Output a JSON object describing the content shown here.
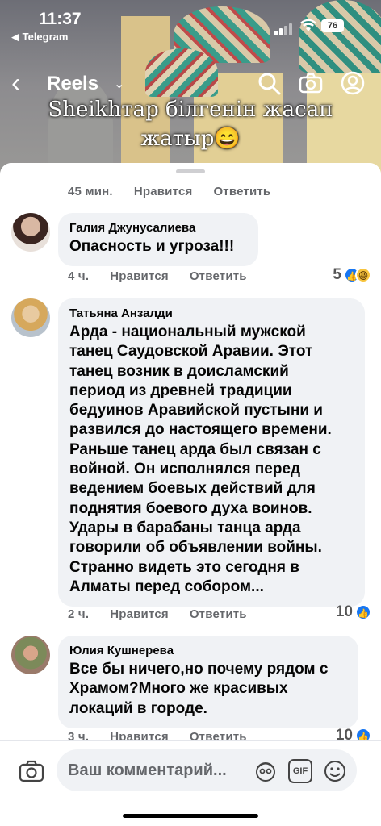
{
  "status_bar": {
    "time": "11:37",
    "back_app": "◀ Telegram",
    "battery": "76"
  },
  "reels_header": {
    "title": "Reels",
    "caption_line1": "Sheikhтар білгенін жасап",
    "caption_line2": "жатыр😄"
  },
  "comments": [
    {
      "meta": {
        "time": "45 мин.",
        "like": "Нравится",
        "reply": "Ответить"
      }
    },
    {
      "author": "Галия Джунусалиева",
      "text": "Опасность и угроза!!!",
      "meta": {
        "time": "4 ч.",
        "like": "Нравится",
        "reply": "Ответить",
        "reaction_count": "5"
      }
    },
    {
      "author": "Татьяна Анзалди",
      "text_lines": [
        "Арда - национальный мужской",
        "танец Саудовской Аравии. Этот",
        "танец возник в доисламский",
        "период из древней традиции",
        "бедуинов Аравийской пустыни и",
        "развился до настоящего времени.",
        "Раньше танец арда был связан с",
        "войной. Он исполнялся перед",
        "ведением боевых действий для",
        "поднятия боевого духа воинов.",
        "Удары в барабаны танца арда",
        "говорили об объявлении войны.",
        "Странно видеть это сегодня в",
        "Алматы перед собором..."
      ],
      "meta": {
        "time": "2 ч.",
        "like": "Нравится",
        "reply": "Ответить",
        "reaction_count": "10"
      }
    },
    {
      "author": "Юлия Кушнерева",
      "text_lines": [
        "Все бы ничего,но почему рядом с",
        "Храмом?Много же красивых",
        "локаций в городе."
      ],
      "meta": {
        "time": "3 ч.",
        "like": "Нравится",
        "reply": "Ответить",
        "reaction_count": "10"
      }
    }
  ],
  "composer": {
    "placeholder": "Ваш комментарий...",
    "gif_label": "GIF"
  },
  "icons": [
    "search-icon",
    "camera-icon",
    "profile-icon",
    "like-reaction-icon",
    "haha-reaction-icon",
    "avatar-sticker-icon",
    "gif-icon",
    "emoji-icon"
  ],
  "colors": {
    "like_blue": "#1877f2",
    "bubble_bg": "#f0f2f5",
    "meta_gray": "#65676b"
  }
}
